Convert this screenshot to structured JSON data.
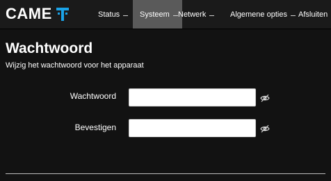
{
  "brand": {
    "name": "CAME"
  },
  "nav": {
    "status": "Status",
    "system": "Systeem",
    "network": "Netwerk",
    "general_options": "Algemene opties",
    "close": "Afsluiten"
  },
  "page": {
    "title": "Wachtwoord",
    "subtitle": "Wijzig het wachtwoord voor het apparaat"
  },
  "form": {
    "password_label": "Wachtwoord",
    "password_value": "",
    "confirm_label": "Bevestigen",
    "confirm_value": ""
  },
  "icons": {
    "toggle_visibility": "eye-slash-icon"
  },
  "colors": {
    "background": "#121212",
    "navbar": "#1a1a1a",
    "active_tab": "#5a5a5a",
    "logo_accent": "#1aa3e8"
  }
}
